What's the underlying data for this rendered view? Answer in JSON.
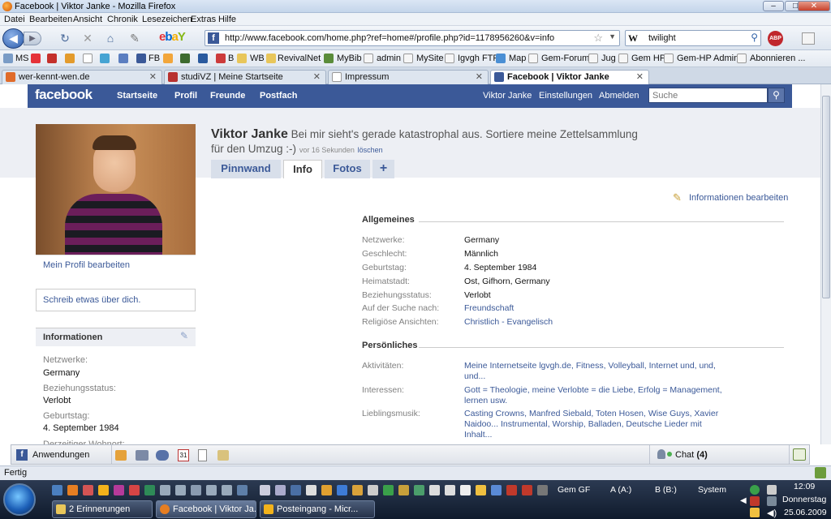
{
  "window": {
    "title": "Facebook | Viktor Janke - Mozilla Firefox"
  },
  "menu": [
    "Datei",
    "Bearbeiten",
    "Ansicht",
    "Chronik",
    "Lesezeichen",
    "Extras",
    "Hilfe"
  ],
  "urlbar": {
    "url": "http://www.facebook.com/home.php?ref=home#/profile.php?id=1178956260&v=info"
  },
  "search": {
    "engine_icon": "W",
    "value": "twilight"
  },
  "bookmarks": [
    "MS",
    "FB",
    "B",
    "WB",
    "RevivalNet",
    "MyBib",
    "admin",
    "MySite",
    "Igvgh FTP",
    "Map",
    "Gem-Forum",
    "Jug",
    "Gem HP",
    "Gem-HP Admin",
    "Abonnieren ..."
  ],
  "tabs": [
    {
      "label": "wer-kennt-wen.de"
    },
    {
      "label": "studiVZ | Meine Startseite"
    },
    {
      "label": "Impressum"
    },
    {
      "label": "Facebook | Viktor Janke"
    }
  ],
  "fb": {
    "logo": "facebook",
    "nav": [
      "Startseite",
      "Profil",
      "Freunde",
      "Postfach"
    ],
    "right_nav": [
      "Viktor Janke",
      "Einstellungen",
      "Abmelden"
    ],
    "search_placeholder": "Suche"
  },
  "profile": {
    "name": "Viktor Janke",
    "status": "Bei mir sieht's gerade katastrophal aus. Sortiere meine Zettelsammlung für den Umzug :-)",
    "time": "vor 16 Sekunden",
    "delete": "löschen",
    "tabs": [
      "Pinnwand",
      "Info",
      "Fotos",
      "+"
    ],
    "edit_profile": "Mein Profil bearbeiten",
    "write_about": "Schreib etwas über dich.",
    "info_box_title": "Informationen",
    "info_box": [
      {
        "label": "Netzwerke:",
        "value": "Germany"
      },
      {
        "label": "Beziehungsstatus:",
        "value": "Verlobt"
      },
      {
        "label": "Geburtstag:",
        "value": "4. September 1984"
      },
      {
        "label": "Derzeitiger Wohnort:",
        "value": ""
      }
    ]
  },
  "info": {
    "edit": "Informationen bearbeiten",
    "general_title": "Allgemeines",
    "general": [
      {
        "label": "Netzwerke:",
        "value": "Germany"
      },
      {
        "label": "Geschlecht:",
        "value": "Männlich"
      },
      {
        "label": "Geburtstag:",
        "value": "4. September 1984"
      },
      {
        "label": "Heimatstadt:",
        "value": "Ost, Gifhorn, Germany"
      },
      {
        "label": "Beziehungsstatus:",
        "value": "Verlobt"
      },
      {
        "label": "Auf der Suche nach:",
        "value": "Freundschaft"
      },
      {
        "label": "Religiöse Ansichten:",
        "value": "Christlich - Evangelisch"
      }
    ],
    "personal_title": "Persönliches",
    "personal": [
      {
        "label": "Aktivitäten:",
        "value": "Meine Internetseite lgvgh.de, Fitness, Volleyball, Internet und, und, und..."
      },
      {
        "label": "Interessen:",
        "value": "Gott = Theologie, meine Verlobte = die Liebe, Erfolg = Management, lernen usw."
      },
      {
        "label": "Lieblingsmusik:",
        "value": "Casting Crowns, Manfred Siebald, Toten Hosen, Wise Guys, Xavier Naidoo... Instrumental, Worship, Balladen, Deutsche Lieder mit Inhalt..."
      }
    ]
  },
  "appbar": {
    "apps": "Anwendungen",
    "chat": "Chat",
    "chat_count": "(4)"
  },
  "statusbar": {
    "text": "Fertig"
  },
  "taskbar": {
    "buttons": [
      "2 Erinnerungen",
      "Facebook | Viktor Ja...",
      "Posteingang - Micr..."
    ],
    "toolbars": [
      "Gem GF",
      "A (A:)",
      "B (B:)",
      "System"
    ],
    "clock_time": "12:09",
    "clock_day": "Donnerstag",
    "clock_date": "25.06.2009"
  },
  "colors": {
    "fb_blue": "#3b5998",
    "link": "#3b5998",
    "profile_bg": "#edeff4"
  }
}
